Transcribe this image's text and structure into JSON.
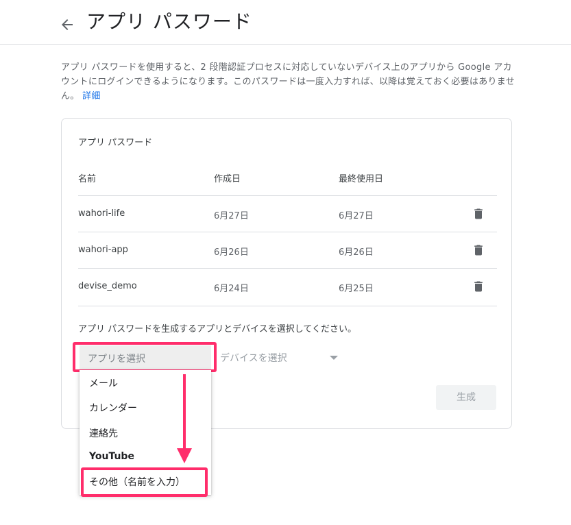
{
  "header": {
    "title": "アプリ パスワード",
    "back_icon": "arrow-back-icon"
  },
  "intro": {
    "text": "アプリ パスワードを使用すると、2 段階認証プロセスに対応していないデバイス上のアプリから Google アカウントにログインできるようになります。このパスワードは一度入力すれば、以降は覚えておく必要はありません。",
    "link_label": "詳細"
  },
  "card": {
    "title": "アプリ パスワード",
    "columns": [
      "名前",
      "作成日",
      "最終使用日"
    ],
    "rows": [
      {
        "name": "wahori-life",
        "created": "6月27日",
        "last_used": "6月27日"
      },
      {
        "name": "wahori-app",
        "created": "6月26日",
        "last_used": "6月26日"
      },
      {
        "name": "devise_demo",
        "created": "6月24日",
        "last_used": "6月25日"
      }
    ],
    "delete_icon": "trash-icon",
    "instruction": "アプリ パスワードを生成するアプリとデバイスを選択してください。",
    "app_select_placeholder": "アプリを選択",
    "device_select_placeholder": "デバイスを選択",
    "generate_label": "生成"
  },
  "menu": {
    "items": [
      "メール",
      "カレンダー",
      "連絡先",
      "YouTube",
      "その他（名前を入力）"
    ]
  },
  "colors": {
    "highlight": "#ff2d6b",
    "link": "#1a73e8",
    "divider": "#dadce0"
  }
}
